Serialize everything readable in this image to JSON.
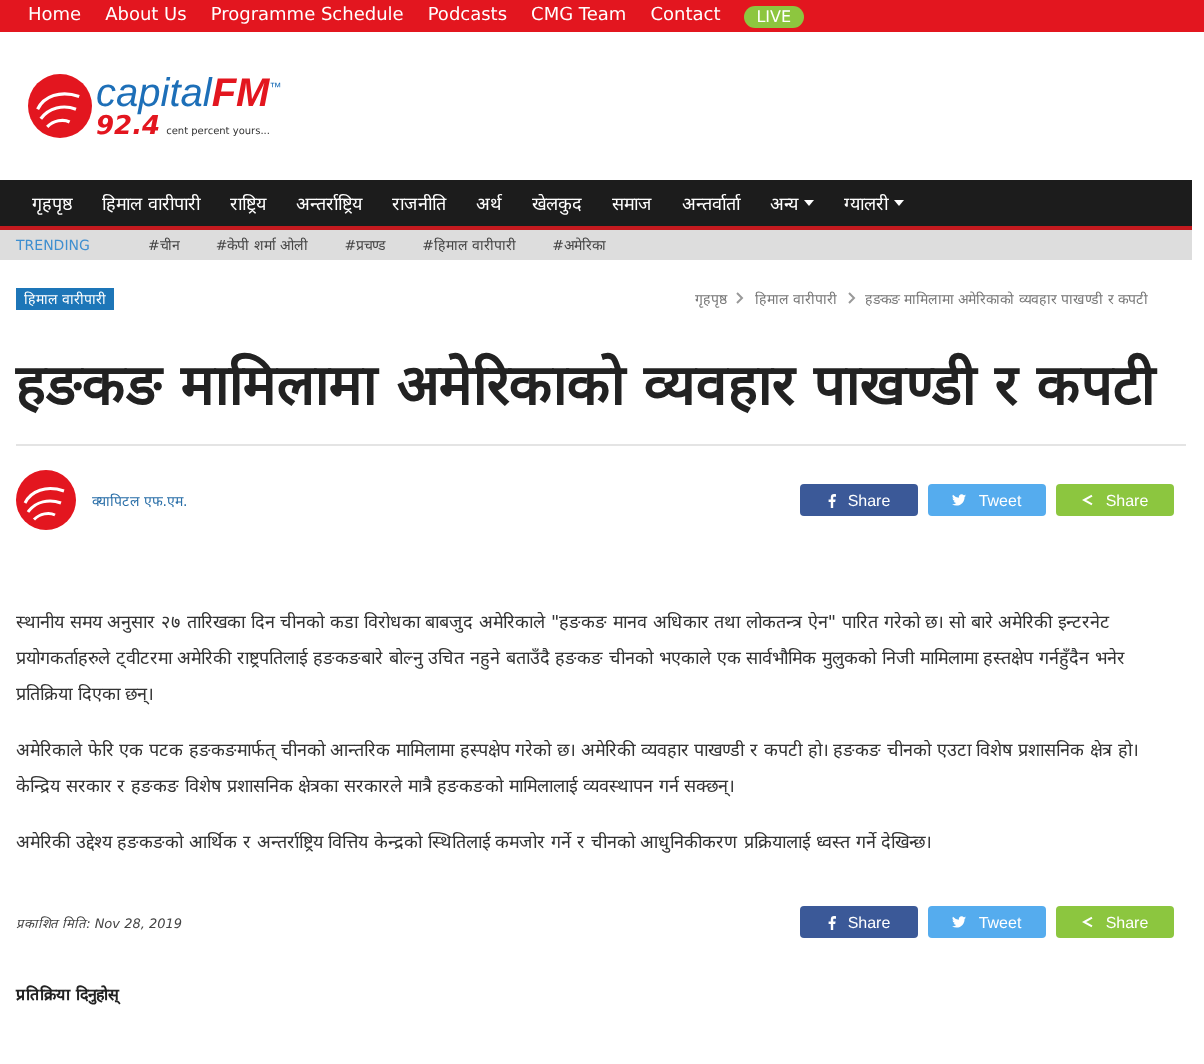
{
  "top_links": [
    "Home",
    "About Us",
    "Programme Schedule",
    "Podcasts",
    "CMG Team",
    "Contact"
  ],
  "live_badge": "LIVE",
  "logo": {
    "name": "capital",
    "name_accent": "FM",
    "trademark": "™",
    "frequency": "92.4",
    "tagline": "cent percent yours..."
  },
  "nav": [
    {
      "label": "गृहपृष्ठ",
      "has_menu": false
    },
    {
      "label": "हिमाल वारीपारी",
      "has_menu": false
    },
    {
      "label": "राष्ट्रिय",
      "has_menu": false
    },
    {
      "label": "अन्तर्राष्ट्रिय",
      "has_menu": false
    },
    {
      "label": "राजनीति",
      "has_menu": false
    },
    {
      "label": "अर्थ",
      "has_menu": false
    },
    {
      "label": "खेलकुद",
      "has_menu": false
    },
    {
      "label": "समाज",
      "has_menu": false
    },
    {
      "label": "अन्तर्वार्ता",
      "has_menu": false
    },
    {
      "label": "अन्य",
      "has_menu": true
    },
    {
      "label": "ग्यालरी",
      "has_menu": true
    }
  ],
  "trending": {
    "label": "TRENDING",
    "tags": [
      "#चीन",
      "#केपी शर्मा ओली",
      "#प्रचण्ड",
      "#हिमाल वारीपारी",
      "#अमेरिका"
    ]
  },
  "category": "हिमाल वारीपारी",
  "breadcrumb": [
    "गृहपृष्ठ",
    "हिमाल वारीपारी",
    "हङकङ मामिलामा अमेरिकाको व्यवहार पाखण्डी र कपटी"
  ],
  "title": "हङकङ मामिलामा अमेरिकाको व्यवहार पाखण्डी र कपटी",
  "author": "क्यापिटल एफ.एम.",
  "share_top": [
    {
      "kind": "facebook",
      "label": "Share"
    },
    {
      "kind": "twitter",
      "label": "Tweet"
    },
    {
      "kind": "share",
      "label": "Share"
    }
  ],
  "paragraphs": [
    "स्थानीय समय अनुसार २७ तारिखका दिन चीनको कडा विरोधका बाबजुद अमेरिकाले \"हङकङ मानव अधिकार तथा लोकतन्त्र ऐन\" पारित गरेको छ। सो बारे अमेरिकी इन्टरनेट प्रयोगकर्ताहरुले ट्वीटरमा अमेरिकी राष्ट्रपतिलाई हङकङबारे बोल्नु उचित नहुने बताउँदै हङकङ चीनको भएकाले एक सार्वभौमिक मुलुकको निजी मामिलामा हस्तक्षेप गर्नहुँदैन भनेर प्रतिक्रिया दिएका छन्।",
    "अमेरिकाले फेरि एक पटक हङकङमार्फत् चीनको आन्तरिक मामिलामा हस्पक्षेप गरेको छ। अमेरिकी व्यवहार पाखण्डी र कपटी हो। हङकङ चीनको एउटा विशेष प्रशासनिक क्षेत्र हो। केन्द्रिय सरकार र हङकङ विशेष प्रशासनिक क्षेत्रका सरकारले मात्रै हङकङको मामिलालाई व्यवस्थापन गर्न सक्छन्।",
    "अमेरिकी उद्देश्य हङकङको आर्थिक र अन्तर्राष्ट्रिय वित्तिय केन्द्रको स्थितिलाई कमजोर गर्ने र चीनको आधुनिकीकरण प्रक्रियालाई ध्वस्त गर्ने देखिन्छ।"
  ],
  "published": "प्रकाशित मिति: Nov 28, 2019",
  "share_bottom": [
    {
      "kind": "facebook",
      "label": "Share"
    },
    {
      "kind": "twitter",
      "label": "Tweet"
    },
    {
      "kind": "share",
      "label": "Share"
    }
  ],
  "comment_heading": "प्रतिक्रिया दिनुहोस्"
}
